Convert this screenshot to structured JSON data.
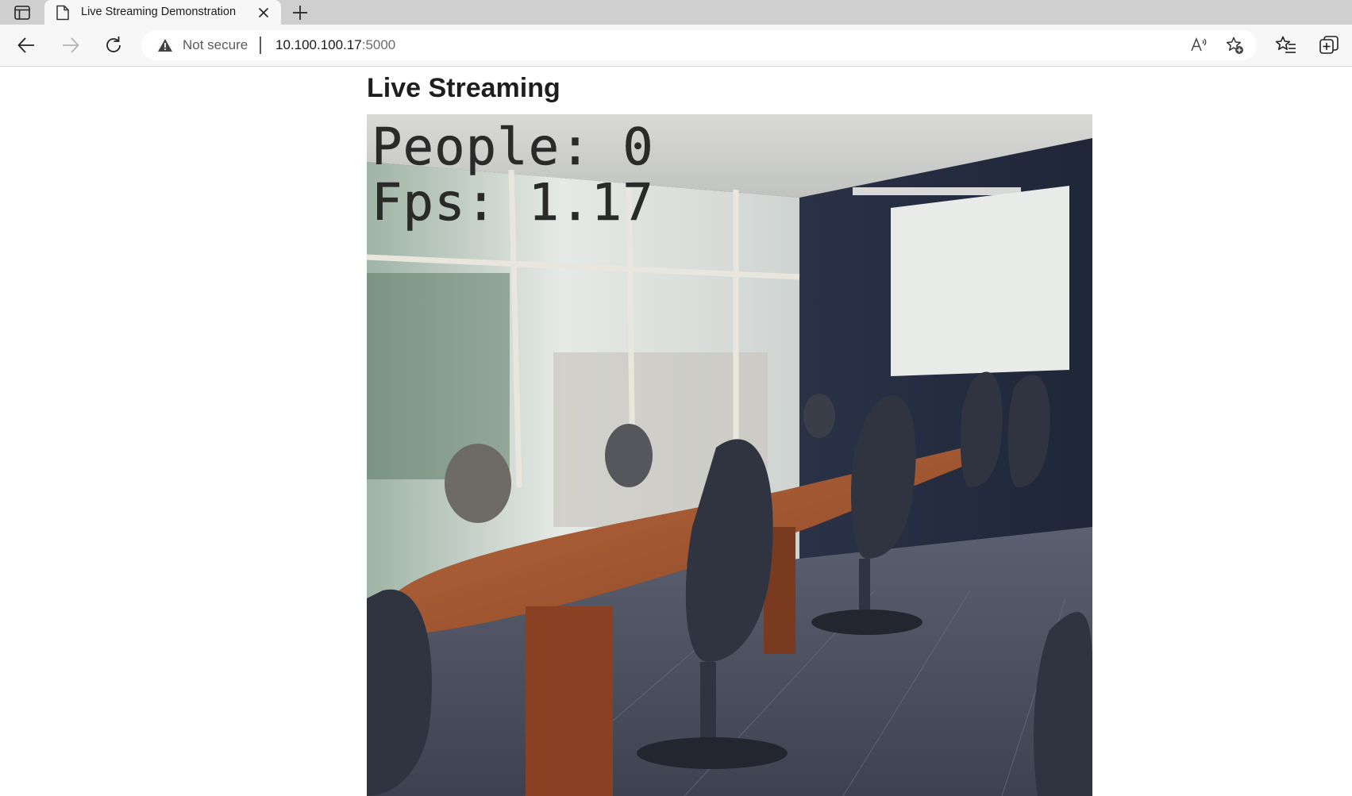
{
  "browser": {
    "tab": {
      "title": "Live Streaming Demonstration"
    },
    "address": {
      "security_label": "Not secure",
      "host": "10.100.100.17",
      "port": ":5000"
    },
    "icons": [
      "tab-actions-icon",
      "page-icon",
      "close-icon",
      "plus-icon",
      "back-icon",
      "forward-icon",
      "refresh-icon",
      "warning-icon",
      "read-aloud-icon",
      "add-favorite-icon",
      "favorites-icon",
      "collections-icon"
    ]
  },
  "page": {
    "heading": "Live Streaming",
    "stream": {
      "people_line": "People: 0",
      "fps_line": "Fps: 1.17"
    }
  }
}
